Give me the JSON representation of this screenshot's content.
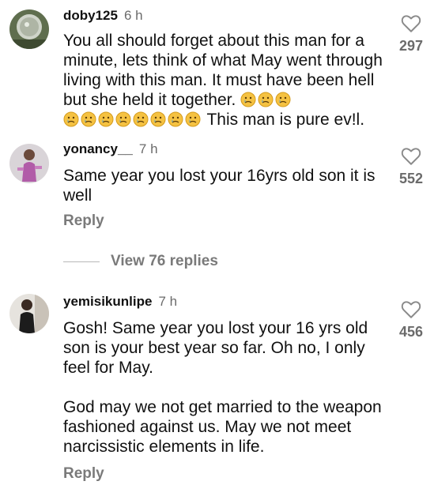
{
  "comments": [
    {
      "username": "doby125",
      "time": "6 h",
      "text_part1": "You all should forget about this man for a minute, lets think of what May went through living with this man. It must have been hell but she held it together. ",
      "text_part2": " This man is pure ev!l.",
      "emoji_name": "sad-face",
      "likes": "297"
    },
    {
      "username": "yonancy__",
      "time": "7 h",
      "text": "Same year you lost your 16yrs old son it is well",
      "reply_label": "Reply",
      "likes": "552",
      "view_replies_label": "View 76 replies"
    },
    {
      "username": "yemisikunlipe",
      "time": "7 h",
      "text_para1": "Gosh! Same year you lost your 16 yrs old son is your best year so far. Oh no, I only feel for May.",
      "text_para2": "God may we not get married to the weapon fashioned against us. May we not meet narcissistic elements in life.",
      "reply_label": "Reply",
      "likes": "456"
    }
  ],
  "icons": {
    "like": "heart-outline-icon",
    "emoji": "sad-face-emoji"
  },
  "colors": {
    "text": "#111111",
    "secondary": "#6b6b6b",
    "emoji_face": "#f5c242",
    "tear": "#4aa3df"
  }
}
